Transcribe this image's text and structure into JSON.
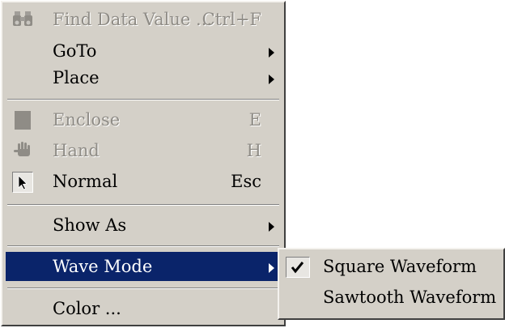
{
  "menu": {
    "items": [
      {
        "label": "Find Data Value ...",
        "shortcut": "Ctrl+F",
        "icon": "binoculars-icon",
        "disabled": true
      },
      {
        "label": "GoTo",
        "submenu": true
      },
      {
        "label": "Place",
        "submenu": true
      },
      {
        "label": "Enclose",
        "shortcut": "E",
        "icon": "enclose-icon",
        "disabled": true
      },
      {
        "label": "Hand",
        "shortcut": "H",
        "icon": "hand-icon",
        "disabled": true
      },
      {
        "label": "Normal",
        "shortcut": "Esc",
        "icon": "pointer-arrow-icon",
        "checked": true
      },
      {
        "label": "Show As",
        "submenu": true
      },
      {
        "label": "Wave Mode",
        "submenu": true,
        "selected": true
      },
      {
        "label": "Color ..."
      }
    ]
  },
  "wave_mode_submenu": {
    "items": [
      {
        "label": "Square Waveform",
        "checked": true
      },
      {
        "label": "Sawtooth Waveform"
      }
    ]
  },
  "colors": {
    "menu_background": "#d4d0c8",
    "highlight": "#0a246a",
    "disabled_text": "#8f8c86"
  }
}
